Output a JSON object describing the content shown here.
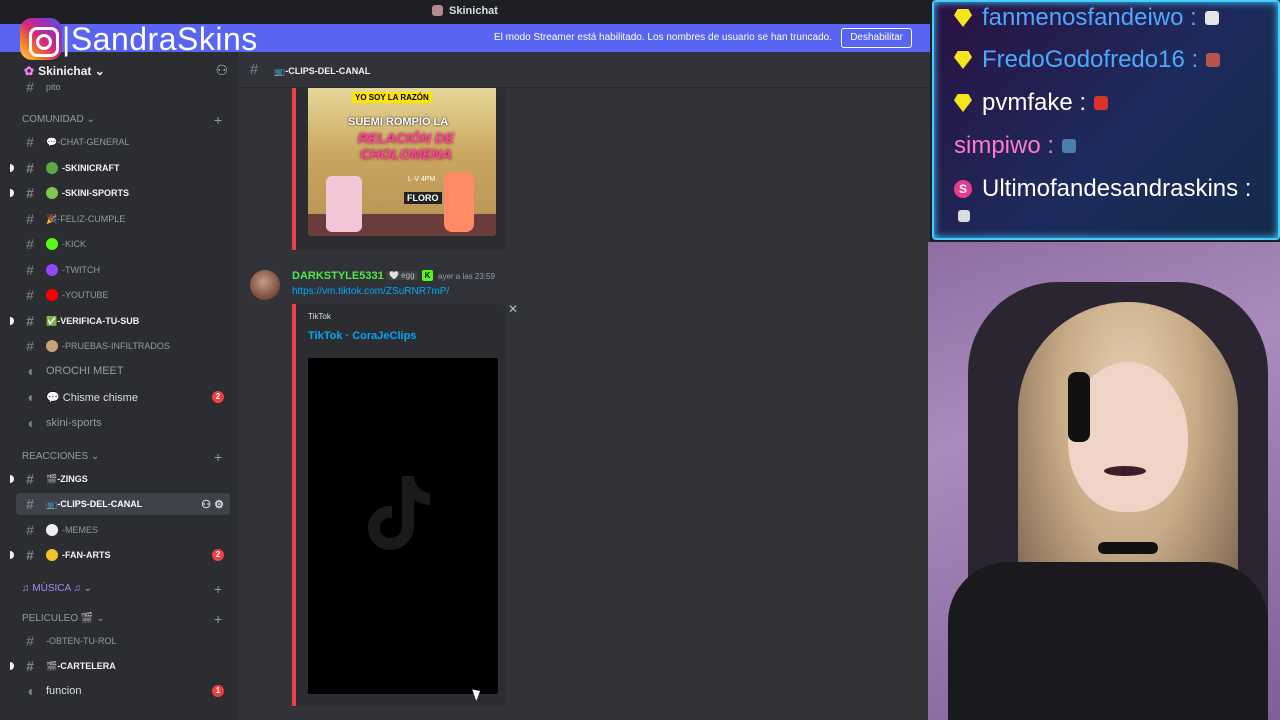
{
  "window": {
    "title": "Skinichat"
  },
  "streamer_mode": {
    "message": "El modo Streamer está habilitado. Los nombres de usuario se han truncado.",
    "disable_label": "Deshabilitar"
  },
  "brand": {
    "name": "|SandraSkins",
    "icon": "instagram-icon"
  },
  "server": {
    "name": "Skinichat",
    "dropdown": "⌄"
  },
  "categories": {
    "comunidad": "COMUNIDAD ⌄",
    "reacciones": "REACCIONES ⌄",
    "musica": "♫ MÚSICA ♫ ⌄",
    "peliculeo": "PELICULEO 🎬 ⌄"
  },
  "channels": {
    "pito": "pito",
    "chat_general": "💬-CHAT-GENERAL",
    "skinicraft": "-SKINICRAFT",
    "skini_sports": "-SKINI-SPORTS",
    "feliz_cumple": "🎉-FELIZ-CUMPLE",
    "kick": "-KICK",
    "twitch": "-TWITCH",
    "youtube": "-YOUTUBE",
    "verifica": "✅-VERIFICA-TU-SUB",
    "pruebas": "-PRUEBAS-INFILTRADOS",
    "orochi": "OROCHI MEET",
    "chisme": "💬 Chisme chisme",
    "skini_sports_voice": "skini-sports",
    "zings": "🎬-ZINGS",
    "clips": "📺-CLIPS-DEL-CANAL",
    "memes": "-MEMES",
    "fan_arts": "-FAN-ARTS",
    "obten": "-OBTEN-TU-ROL",
    "cartelera": "🎬-CARTELERA",
    "funcion": "funcion"
  },
  "badges": {
    "chisme": "2",
    "fan_arts": "2",
    "funcion": "1"
  },
  "chat_header": {
    "channel": "📺-CLIPS-DEL-CANAL"
  },
  "thumbnail": {
    "line1": "YO SOY LA RAZÓN",
    "line2": "SUEMI ROMPIÓ LA",
    "line3": "RELACIÓN DE CHOLOMENA",
    "logo": "FLORO",
    "time": "L-V 4PM"
  },
  "message": {
    "author": "DARKSTYLE5331",
    "tag": "🤍 egg",
    "timestamp": "ayer a las 23:59",
    "link": "https://vm.tiktok.com/ZSuRNR7mP/",
    "embed_provider": "TikTok",
    "embed_title": "TikTok · CoraJeClips"
  },
  "stream_chat": [
    {
      "user": "fanmenosfandeiwo :",
      "icon": "gem-icon",
      "color": "#4fa8ff"
    },
    {
      "user": "FredoGodofredo16 :",
      "icon": "gem-icon",
      "color": "#4fa8ff"
    },
    {
      "user": "pvmfake :",
      "icon": "gem-icon",
      "color": "#ffffff"
    },
    {
      "user": "simpiwo :",
      "icon": "none",
      "color": "#ff7ac8"
    },
    {
      "user": "Ultimofandesandraskins :",
      "icon": "s-badge-icon",
      "color": "#ffffff"
    }
  ],
  "colors": {
    "accent": "#5865f2",
    "unread": "#f23f43",
    "author": "#4de94c",
    "embed_bar": "#ed4245"
  }
}
